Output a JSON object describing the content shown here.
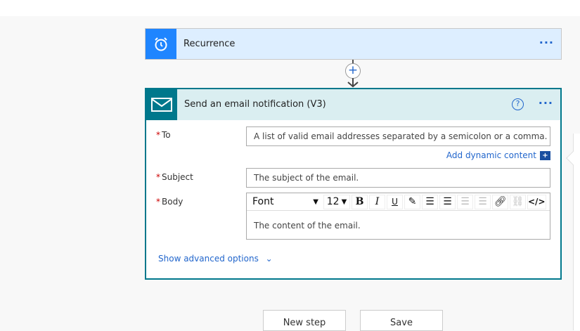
{
  "trigger": {
    "title": "Recurrence",
    "icon": "alarm-clock-icon",
    "more": "···"
  },
  "connector": {
    "add": "+"
  },
  "action": {
    "title": "Send an email notification (V3)",
    "icon": "mail-icon",
    "help": "?",
    "more": "···",
    "fields": {
      "to": {
        "label": "To",
        "required": "*",
        "placeholder": "A list of valid email addresses separated by a semicolon or a comma."
      },
      "subject": {
        "label": "Subject",
        "required": "*",
        "placeholder": "The subject of the email."
      },
      "body": {
        "label": "Body",
        "required": "*",
        "placeholder": "The content of the email."
      }
    },
    "dynamic_content": "Add dynamic content",
    "dynamic_icon": "+",
    "toolbar": {
      "font": "Font",
      "size": "12",
      "bold": "B",
      "italic": "I",
      "underline": "U",
      "code": "</>"
    },
    "advanced": "Show advanced options"
  },
  "buttons": {
    "new_step": "New step",
    "save": "Save"
  },
  "colors": {
    "trigger": "#1f85ff",
    "action": "#00788c",
    "link": "#2266cc"
  }
}
